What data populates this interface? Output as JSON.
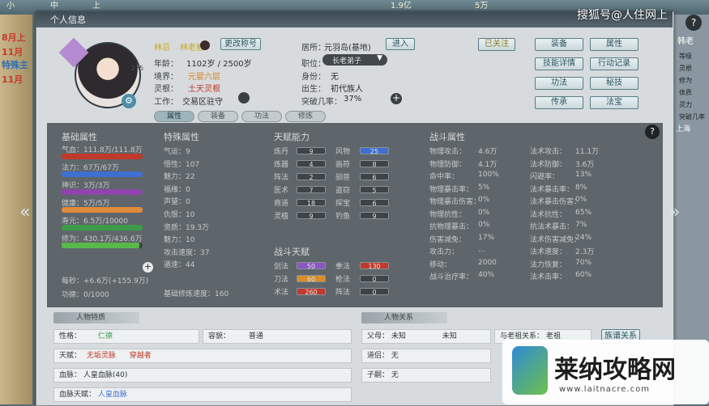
{
  "world": {
    "top_stats": [
      "小",
      "中",
      "上",
      "1.9亿",
      "5万"
    ],
    "left_notes": [
      "8月上",
      "11月",
      "特殊主",
      "11月"
    ],
    "right_notes": [
      "韩老",
      "上海"
    ],
    "right_list": [
      "等级",
      "灵根",
      "修为",
      "体质",
      "灵力",
      "突破几率"
    ]
  },
  "panel": {
    "title": "个人信息"
  },
  "profile": {
    "name_label": "林忌",
    "name": "林老板",
    "badge": "275",
    "title_button": "更改称号",
    "age_label": "年龄：",
    "age": "1102岁 / 2500岁",
    "realm_label": "境界：",
    "realm": "元婴六层",
    "root_label": "灵根：",
    "root": "土天灵根",
    "job_label": "工作：",
    "job": "交易区驻守",
    "residence_label": "居所：",
    "residence": "元羽岛(基地)",
    "enter_button": "进入",
    "position_label": "职位：",
    "position": "长老弟子",
    "identity_label": "身份：",
    "identity": "无",
    "birth_label": "出生：",
    "birth": "初代族人",
    "breakthrough_label": "突破几率：",
    "breakthrough": "37%"
  },
  "right_buttons": [
    "已关注",
    "装备",
    "属性",
    "技能详情",
    "行动记录",
    "功法",
    "秘技",
    "传承",
    "法宝"
  ],
  "tabs": [
    "属性",
    "装备",
    "功法",
    "修炼"
  ],
  "basic_attr": {
    "title": "基础属性",
    "rows": [
      {
        "label": "气血：111.8万/111.8万",
        "fill": 1.0,
        "color": "#c0392b"
      },
      {
        "label": "法力：67万/67万",
        "fill": 1.0,
        "color": "#3f6fd0"
      },
      {
        "label": "神识：3万/3万",
        "fill": 1.0,
        "color": "#8e44ad"
      },
      {
        "label": "健康：5万/5万",
        "fill": 1.0,
        "color": "#e08a3c"
      },
      {
        "label": "寿元：6.5万/10000",
        "fill": 1.0,
        "color": "#3e9a4b"
      },
      {
        "label": "修为：430.1万/436.6万",
        "fill": 0.96,
        "color": "#58b84a"
      }
    ],
    "extra": [
      "每秒：+6.6万(+155.9万)",
      "功德：0/1000"
    ]
  },
  "special_attr": {
    "title": "特殊属性",
    "rows": [
      "气运：9",
      "悟性：107",
      "魅力：22",
      "福缘：0",
      "声望：0",
      "仇恨：10",
      "资质：19.3万",
      "魅力：10",
      "攻击速度：37",
      "遁速：44"
    ],
    "extra": "基础修炼速度：160"
  },
  "talent": {
    "title": "天赋能力",
    "rows": [
      {
        "a": "炼丹",
        "av": 9,
        "b": "风物",
        "bv": 25
      },
      {
        "a": "炼器",
        "av": 4,
        "b": "画符",
        "bv": 8
      },
      {
        "a": "阵法",
        "av": 2,
        "b": "驯兽",
        "bv": 6
      },
      {
        "a": "医术",
        "av": 7,
        "b": "盗窃",
        "bv": 5
      },
      {
        "a": "商道",
        "av": 18,
        "b": "探宝",
        "bv": 6
      },
      {
        "a": "灵植",
        "av": 9,
        "b": "钓鱼",
        "bv": 9
      }
    ]
  },
  "battle_skill": {
    "title": "战斗天赋",
    "rows": [
      {
        "a": "剑法",
        "av": 50,
        "ac": "#8a56c2",
        "b": "拳法",
        "bv": 130,
        "bc": "#c0392b"
      },
      {
        "a": "刀法",
        "av": 60,
        "ac": "#d98d2b",
        "b": "枪法",
        "bv": 0,
        "bc": ""
      },
      {
        "a": "术法",
        "av": 260,
        "ac": "#c0392b",
        "b": "阵法",
        "bv": 0,
        "bc": ""
      }
    ]
  },
  "combat_attr": {
    "title": "战斗属性",
    "rows": [
      {
        "a": "物理攻击：",
        "av": "4.6万",
        "b": "法术攻击：",
        "bv": "11.1万"
      },
      {
        "a": "物理防御：",
        "av": "4.1万",
        "b": "法术防御：",
        "bv": "3.6万"
      },
      {
        "a": "命中率：",
        "av": "100%",
        "b": "闪避率：",
        "bv": "13%"
      },
      {
        "a": "物理暴击率：",
        "av": "5%",
        "b": "法术暴击率：",
        "bv": "8%"
      },
      {
        "a": "物理暴击伤害：",
        "av": "0%",
        "b": "法术暴击伤害：",
        "bv": "0%"
      },
      {
        "a": "物理抗性：",
        "av": "0%",
        "b": "法术抗性：",
        "bv": "65%"
      },
      {
        "a": "抗物理暴击：",
        "av": "0%",
        "b": "抗法术暴击：",
        "bv": "7%"
      },
      {
        "a": "伤害减免：",
        "av": "17%",
        "b": "法术伤害减免：",
        "bv": "24%"
      },
      {
        "a": "攻击力：",
        "av": "...",
        "b": "法术速度：",
        "bv": "2.3万"
      },
      {
        "a": "移动：",
        "av": "2000",
        "b": "法力恢复：",
        "bv": "70%"
      },
      {
        "a": "战斗治疗率：",
        "av": "40%",
        "b": "法术击率：",
        "bv": "60%"
      }
    ]
  },
  "character_detail": {
    "title": "人物特质",
    "personality_label": "性格：",
    "personality": "仁德",
    "looks_label": "容貌：",
    "looks": "普通",
    "talent_label": "天赋：",
    "talent_a": "无垢灵脉",
    "talent_b": "穿越者",
    "bloodline_label": "血脉：",
    "bloodline": "人皇血脉(40)",
    "bloodline_talent_label": "血脉天赋：",
    "bloodline_talent": "人皇血脉"
  },
  "relations": {
    "title": "人物关系",
    "parents_label": "父母：",
    "father": "未知",
    "mother": "未知",
    "ancestor_label": "与老祖关系：",
    "ancestor": "老祖",
    "master_label": "道侣：",
    "master": "无",
    "children_label": "子嗣：",
    "children": "无",
    "family_button": "族谱关系"
  },
  "watermarks": {
    "sohu": "搜狐号@人住网上",
    "logo_text": "莱纳攻略网",
    "logo_url": "www.laitnacre.com"
  }
}
